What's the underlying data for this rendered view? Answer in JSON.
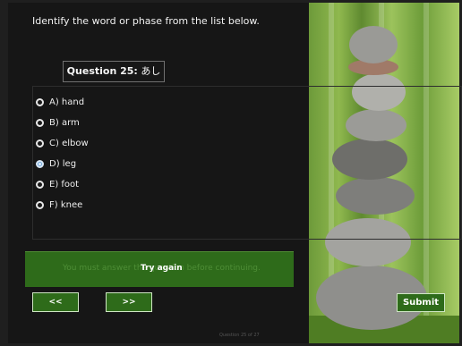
{
  "instruction": "Identify the  word or phase from the list below.",
  "question": {
    "label": "Question 25:",
    "word": "あし"
  },
  "options": [
    {
      "label": "A) hand",
      "selected": false
    },
    {
      "label": "B) arm",
      "selected": false
    },
    {
      "label": "C) elbow",
      "selected": false
    },
    {
      "label": "D) leg",
      "selected": true
    },
    {
      "label": "E) foot",
      "selected": false
    },
    {
      "label": "F) knee",
      "selected": false
    }
  ],
  "feedback": {
    "message": "You must answer the question before continuing.",
    "try_again": "Try again"
  },
  "nav": {
    "prev": "<<",
    "next": ">>"
  },
  "submit": "Submit",
  "progress": "Question 25 of 27",
  "colors": {
    "accent_green": "#2e6b1a",
    "selected_radio": "#6fa8dc"
  },
  "image": "stacked-stones-bamboo-photo"
}
